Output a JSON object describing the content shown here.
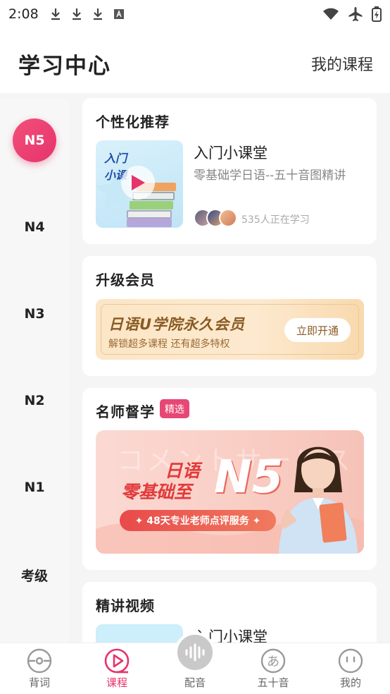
{
  "status_bar": {
    "time": "2:08"
  },
  "header": {
    "title": "学习中心",
    "my_courses": "我的课程"
  },
  "sidebar": {
    "levels": [
      "N5",
      "N4",
      "N3",
      "N2",
      "N1",
      "考级"
    ],
    "active": "N5"
  },
  "recommend": {
    "title": "个性化推荐",
    "thumb_text_1": "入门",
    "thumb_text_2": "小课",
    "course_title": "入门小课堂",
    "course_subtitle": "零基础学日语--五十音图精讲",
    "learners": "535人正在学习"
  },
  "vip": {
    "title": "升级会员",
    "banner_title": "日语U学院永久会员",
    "banner_sub": "解锁超多课程  还有超多特权",
    "button": "立即开通"
  },
  "teacher": {
    "title": "名师督学",
    "badge": "精选",
    "banner_bg": "コメントサービス",
    "line1": "日语",
    "line2": "零基础至",
    "level": "N5",
    "pill": "✦ 48天专业老师点评服务 ✦"
  },
  "videos": {
    "title": "精讲视频",
    "course_title": "入门小课堂"
  },
  "tabs": [
    {
      "label": "背词",
      "icon": "target-icon"
    },
    {
      "label": "课程",
      "icon": "play-icon",
      "active": true
    },
    {
      "label": "配音",
      "icon": "mic-wave-icon"
    },
    {
      "label": "五十音",
      "icon": "kana-icon"
    },
    {
      "label": "我的",
      "icon": "face-icon"
    }
  ],
  "colors": {
    "accent": "#e6336c",
    "vip_text": "#8a5a23",
    "banner_red": "#e23a3a"
  }
}
